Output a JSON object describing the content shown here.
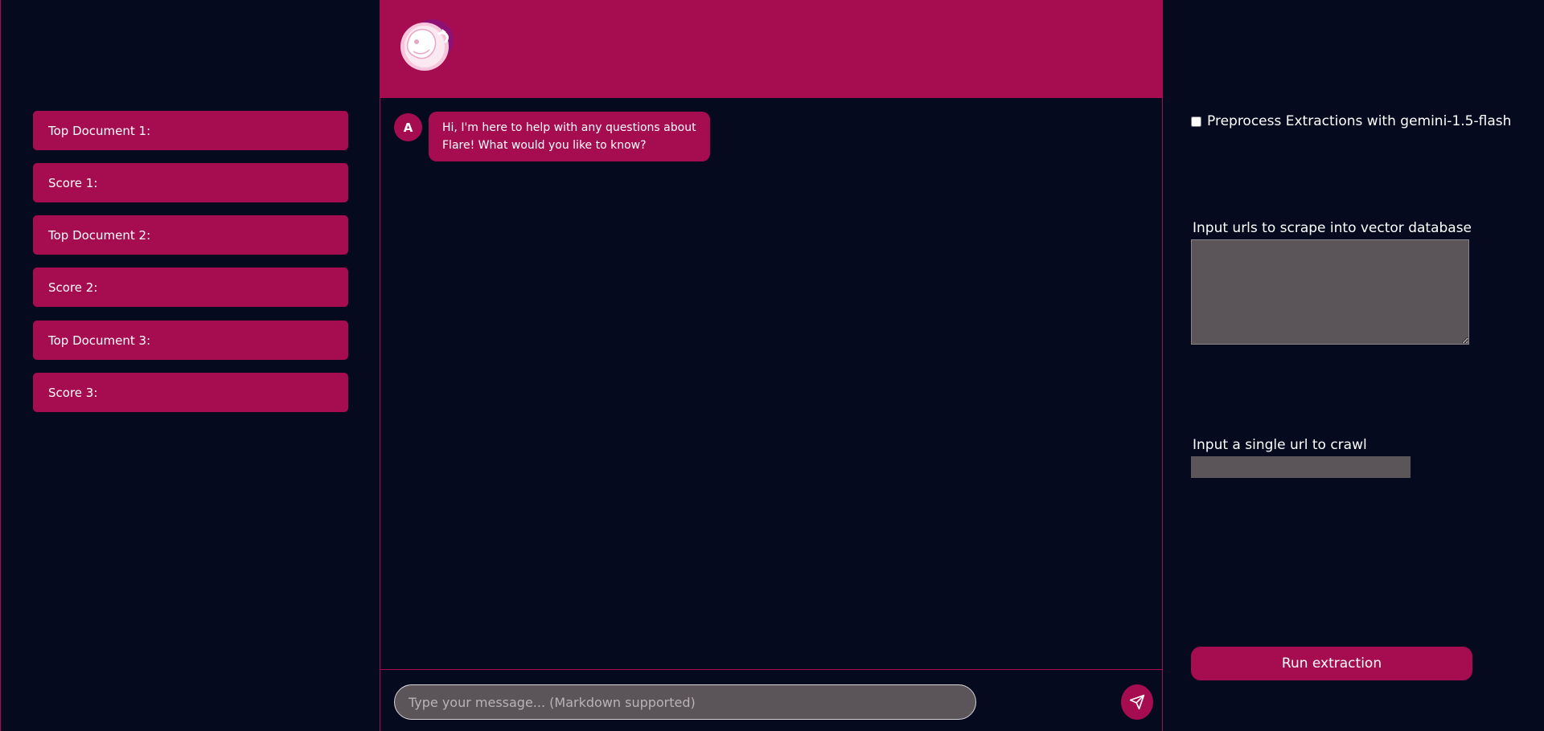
{
  "sidebar": {
    "items": [
      {
        "label": "Top Document 1:"
      },
      {
        "label": "Score 1:"
      },
      {
        "label": "Top Document 2:"
      },
      {
        "label": "Score 2:"
      },
      {
        "label": "Top Document 3:"
      },
      {
        "label": "Score 3:"
      }
    ]
  },
  "chat": {
    "logo_icon": "embryo-logo",
    "messages": [
      {
        "sender_initial": "A",
        "text": "Hi, I'm here to help with any questions about Flare! What would you like to know?"
      }
    ],
    "input_placeholder": "Type your message... (Markdown supported)",
    "input_value": "",
    "send_icon": "paper-plane-icon"
  },
  "settings": {
    "preprocess_label": "Preprocess Extractions with gemini-1.5-flash",
    "preprocess_checked": false,
    "urls_label": "Input urls to scrape into vector database",
    "urls_value": "",
    "single_url_label": "Input a single url to crawl",
    "single_url_value": "",
    "run_button_label": "Run extraction"
  },
  "colors": {
    "background": "#050a1e",
    "accent": "#a60d50",
    "input_background": "#5b5459"
  }
}
